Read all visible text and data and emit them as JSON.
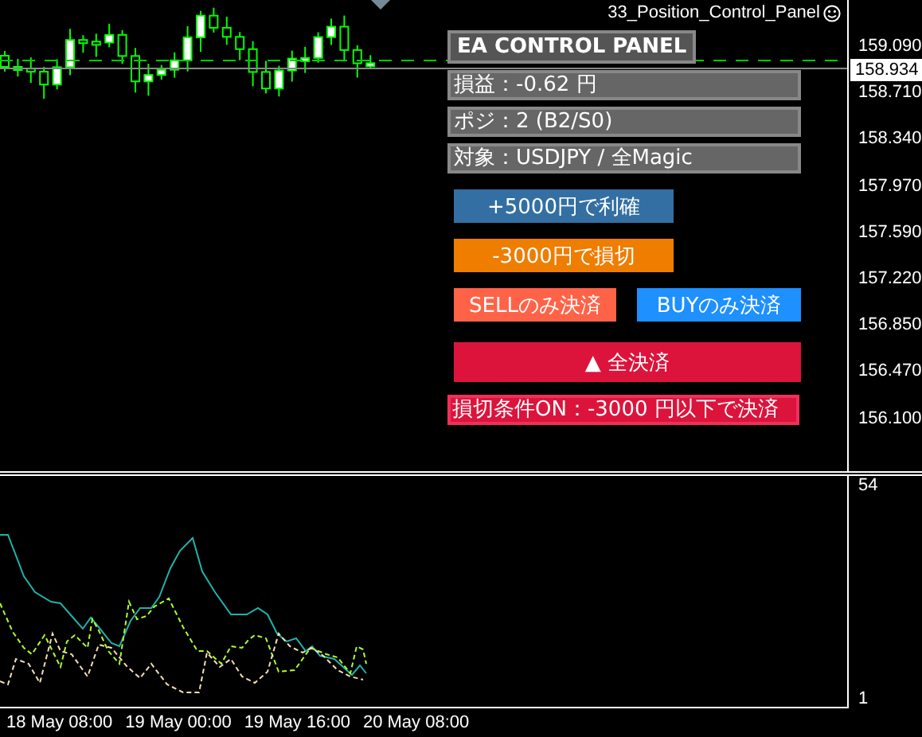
{
  "chart_title": "33_Position_Control_Panel",
  "panel": {
    "title": "EA CONTROL PANEL",
    "info": [
      "損益：-0.62 円",
      "ポジ：2 (B2/S0)",
      "対象：USDJPY / 全Magic"
    ],
    "button_rows": [
      [
        {
          "label": "+5000円で利確",
          "color": "#336fa3"
        }
      ],
      [
        {
          "label": "-3000円で損切",
          "color": "#ee7d00"
        }
      ],
      [
        {
          "label": "SELLのみ決済",
          "color": "#ff6347"
        },
        {
          "label": "BUYのみ決済",
          "color": "#1e90ff"
        }
      ],
      [
        {
          "label": "▲ 全決済",
          "color": "#dc143c"
        }
      ]
    ],
    "status": "損切条件ON：-3000 円以下で決済"
  },
  "price_axis": {
    "labels": [
      "159.090",
      "158.710",
      "158.340",
      "157.970",
      "157.590",
      "157.220",
      "156.850",
      "156.470",
      "156.100"
    ],
    "current": "158.934"
  },
  "indicator_axis": {
    "max": "54",
    "min": "1"
  },
  "time_axis": [
    "18 May 08:00",
    "19 May 00:00",
    "19 May 16:00",
    "20 May 08:00"
  ]
}
